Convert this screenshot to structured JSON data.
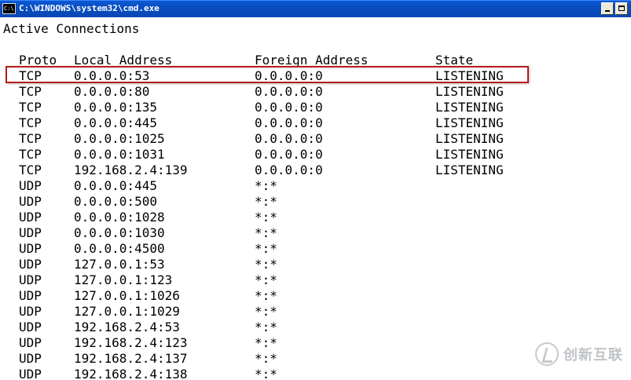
{
  "window": {
    "title": "C:\\WINDOWS\\system32\\cmd.exe",
    "icon_label": "C:\\"
  },
  "console": {
    "heading": "Active Connections",
    "headers": {
      "proto": "Proto",
      "local": "Local Address",
      "foreign": "Foreign Address",
      "state": "State"
    },
    "rows": [
      {
        "proto": "TCP",
        "local": "0.0.0.0:53",
        "foreign": "0.0.0.0:0",
        "state": "LISTENING"
      },
      {
        "proto": "TCP",
        "local": "0.0.0.0:80",
        "foreign": "0.0.0.0:0",
        "state": "LISTENING"
      },
      {
        "proto": "TCP",
        "local": "0.0.0.0:135",
        "foreign": "0.0.0.0:0",
        "state": "LISTENING"
      },
      {
        "proto": "TCP",
        "local": "0.0.0.0:445",
        "foreign": "0.0.0.0:0",
        "state": "LISTENING"
      },
      {
        "proto": "TCP",
        "local": "0.0.0.0:1025",
        "foreign": "0.0.0.0:0",
        "state": "LISTENING"
      },
      {
        "proto": "TCP",
        "local": "0.0.0.0:1031",
        "foreign": "0.0.0.0:0",
        "state": "LISTENING"
      },
      {
        "proto": "TCP",
        "local": "192.168.2.4:139",
        "foreign": "0.0.0.0:0",
        "state": "LISTENING"
      },
      {
        "proto": "UDP",
        "local": "0.0.0.0:445",
        "foreign": "*:*",
        "state": ""
      },
      {
        "proto": "UDP",
        "local": "0.0.0.0:500",
        "foreign": "*:*",
        "state": ""
      },
      {
        "proto": "UDP",
        "local": "0.0.0.0:1028",
        "foreign": "*:*",
        "state": ""
      },
      {
        "proto": "UDP",
        "local": "0.0.0.0:1030",
        "foreign": "*:*",
        "state": ""
      },
      {
        "proto": "UDP",
        "local": "0.0.0.0:4500",
        "foreign": "*:*",
        "state": ""
      },
      {
        "proto": "UDP",
        "local": "127.0.0.1:53",
        "foreign": "*:*",
        "state": ""
      },
      {
        "proto": "UDP",
        "local": "127.0.0.1:123",
        "foreign": "*:*",
        "state": ""
      },
      {
        "proto": "UDP",
        "local": "127.0.0.1:1026",
        "foreign": "*:*",
        "state": ""
      },
      {
        "proto": "UDP",
        "local": "127.0.0.1:1029",
        "foreign": "*:*",
        "state": ""
      },
      {
        "proto": "UDP",
        "local": "192.168.2.4:53",
        "foreign": "*:*",
        "state": ""
      },
      {
        "proto": "UDP",
        "local": "192.168.2.4:123",
        "foreign": "*:*",
        "state": ""
      },
      {
        "proto": "UDP",
        "local": "192.168.2.4:137",
        "foreign": "*:*",
        "state": ""
      },
      {
        "proto": "UDP",
        "local": "192.168.2.4:138",
        "foreign": "*:*",
        "state": ""
      }
    ],
    "highlighted_row": 0
  },
  "watermark": {
    "text": "创新互联"
  },
  "colors": {
    "titlebar": "#0a4ec1",
    "highlight": "#b51c1c",
    "console_bg": "#ffffff",
    "console_text": "#000000"
  }
}
